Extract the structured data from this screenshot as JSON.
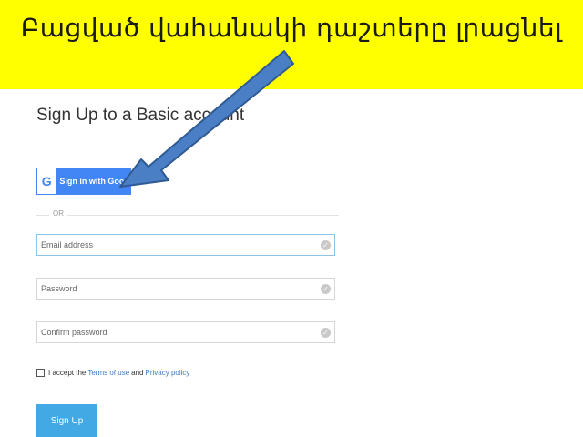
{
  "banner": {
    "title": "Բացված վահանակի դաշտերը լրացնել"
  },
  "form": {
    "title": "Sign Up to a Basic account",
    "google_button_letter": "G",
    "google_button_label": "Sign in with Google",
    "divider_text": "OR",
    "email_placeholder": "Email address",
    "password_placeholder": "Password",
    "confirm_placeholder": "Confirm password",
    "terms_prefix": "I accept the",
    "terms_link": "Terms of use",
    "terms_and": "and",
    "privacy_link": "Privacy policy",
    "signup_label": "Sign Up"
  },
  "colors": {
    "banner_bg": "#ffff00",
    "google_blue": "#4285f4",
    "signup_blue": "#42a9e4",
    "arrow_fill": "#4a7fc5",
    "arrow_stroke": "#2f5a92"
  },
  "icons": {
    "field_status": "check-circle-icon",
    "annotation": "arrow-icon"
  }
}
